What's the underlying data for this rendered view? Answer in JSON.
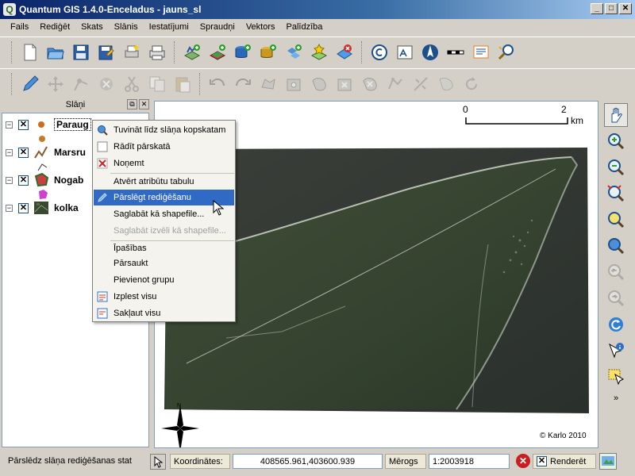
{
  "window": {
    "title": "Quantum GIS 1.4.0-Enceladus - jauns_sl",
    "app_icon_letter": "Q",
    "min": "_",
    "max": "□",
    "close": "✕"
  },
  "menu": [
    "Fails",
    "Rediģēt",
    "Skats",
    "Slānis",
    "Iestatījumi",
    "Spraudņi",
    "Vektors",
    "Palīdzība"
  ],
  "layers_panel": {
    "title": "Slāņi",
    "float_btn": "⧉",
    "close_btn": "✕",
    "layers": [
      {
        "name": "Paraug",
        "checked": "✕",
        "expander": "−"
      },
      {
        "name": "Marsru",
        "checked": "✕",
        "expander": "−"
      },
      {
        "name": "Nogab",
        "checked": "✕",
        "expander": "−"
      },
      {
        "name": "kolka",
        "checked": "✕",
        "expander": "−"
      }
    ]
  },
  "context_menu": {
    "items": [
      "Tuvināt līdz slāņa kopskatam",
      "Rādīt pārskatā",
      "Noņemt",
      "Atvērt atribūtu tabulu",
      "Pārslēgt rediģēšanu",
      "Saglabāt kā shapefile...",
      "Saglabāt izvēli kā shapefile...",
      "Īpašības",
      "Pārsaukt",
      "Pievienot grupu",
      "Izplest visu",
      "Sakļaut visu"
    ],
    "highlighted": "Pārslēgt rediģēšanu",
    "disabled": "Saglabāt izvēli kā shapefile..."
  },
  "map": {
    "scale_start": "0",
    "scale_end": "2",
    "scale_unit": "km",
    "north_label": "N",
    "copyright": "© Karlo 2010"
  },
  "status": {
    "message": "Pārslēdz slāņa rediģēšanas stat",
    "coords_label": "Koordinātes:",
    "coords_value": "408565.961,403600.939",
    "scale_label": "Mērogs",
    "scale_value": "1:2003918",
    "render_label": "Renderēt",
    "render_checked": "✕"
  },
  "colors": {
    "title_gradient_start": "#0a246a",
    "highlight": "#316ac5",
    "panel_bg": "#d4d0c8"
  }
}
